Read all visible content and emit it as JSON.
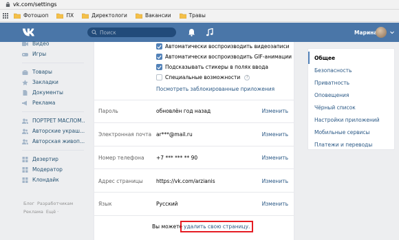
{
  "browser": {
    "url": "vk.com/settings",
    "bookmarks": [
      "Фотошоп",
      "ПХ",
      "Директологи",
      "Вакансии",
      "Травы"
    ]
  },
  "header": {
    "search_placeholder": "Поиск",
    "user_name": "Марина",
    "bg_color": "#4a76a8"
  },
  "left_nav": {
    "group1": [
      {
        "label": "Видео",
        "icon": "video-icon"
      },
      {
        "label": "Игры",
        "icon": "gamepad-icon"
      }
    ],
    "group2": [
      {
        "label": "Товары",
        "icon": "bag-icon"
      },
      {
        "label": "Закладки",
        "icon": "star-icon"
      },
      {
        "label": "Документы",
        "icon": "document-icon"
      },
      {
        "label": "Реклама",
        "icon": "megaphone-icon"
      }
    ],
    "group3": [
      {
        "label": "ПОРТРЕТ МАСЛОМ...",
        "icon": "users-icon"
      },
      {
        "label": "Авторские украш...",
        "icon": "users-icon"
      },
      {
        "label": "Авторская живоп...",
        "icon": "users-icon"
      }
    ],
    "group4": [
      {
        "label": "Дезертир",
        "icon": "app-icon"
      },
      {
        "label": "Модератор",
        "icon": "app-icon"
      },
      {
        "label": "Клондайк",
        "icon": "app-icon"
      }
    ]
  },
  "footer_links": {
    "blog": "Блог",
    "developers": "Разработчикам",
    "ads": "Реклама",
    "more": "Ещё ·"
  },
  "checkboxes": [
    {
      "label": "Автоматически воспроизводить видеозаписи",
      "checked": true
    },
    {
      "label": "Автоматически воспроизводить GIF-анимации",
      "checked": true
    },
    {
      "label": "Подсказывать стикеры в полях ввода",
      "checked": true
    },
    {
      "label": "Специальные возможности",
      "checked": false
    }
  ],
  "blocked_apps_link": "Посмотреть заблокированные приложения",
  "settings_rows": [
    {
      "label": "Пароль",
      "value": "обновлён год назад",
      "edit": "Изменить"
    },
    {
      "label": "Электронная почта",
      "value": "ar***@mail.ru",
      "edit": "Изменить"
    },
    {
      "label": "Номер телефона",
      "value": "+7 *** *** ** 90",
      "edit": "Изменить"
    },
    {
      "label": "Адрес страницы",
      "value": "https://vk.com/arzianis",
      "edit": "Изменить"
    },
    {
      "label": "Язык",
      "value": "Русский",
      "edit": "Изменить"
    }
  ],
  "bottom": {
    "prefix": "Вы можете",
    "delete_link": "удалить свою страницу."
  },
  "right_menu": [
    {
      "label": "Общее",
      "active": true
    },
    {
      "label": "Безопасность",
      "active": false
    },
    {
      "label": "Приватность",
      "active": false
    },
    {
      "label": "Оповещения",
      "active": false
    },
    {
      "label": "Чёрный список",
      "active": false
    },
    {
      "label": "Настройки приложений",
      "active": false
    },
    {
      "label": "Мобильные сервисы",
      "active": false
    },
    {
      "label": "Платежи и переводы",
      "active": false
    }
  ]
}
